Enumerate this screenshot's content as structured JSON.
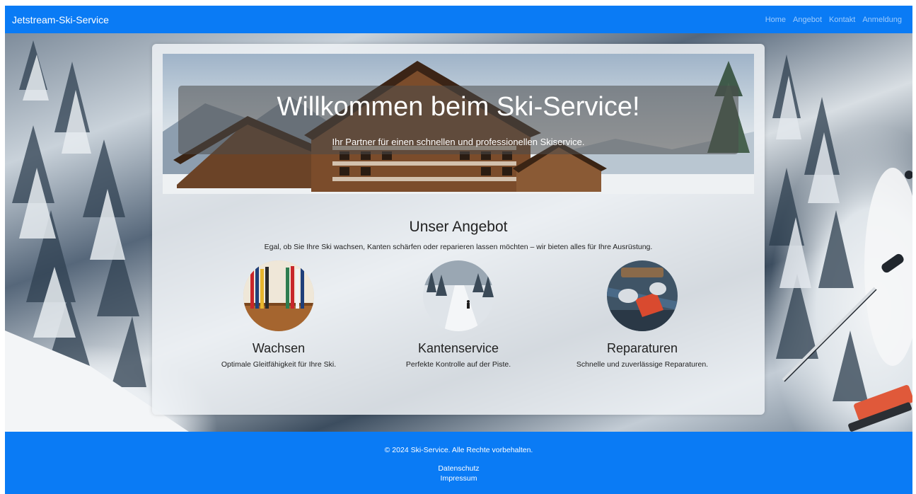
{
  "navbar": {
    "brand": "Jetstream-Ski-Service",
    "links": [
      "Home",
      "Angebot",
      "Kontakt",
      "Anmeldung"
    ]
  },
  "hero": {
    "title": "Willkommen beim Ski-Service!",
    "subtitle": "Ihr Partner für einen schnellen und professionellen Skiservice."
  },
  "offer": {
    "title": "Unser Angebot",
    "subtitle": "Egal, ob Sie Ihre Ski wachsen, Kanten schärfen oder reparieren lassen möchten – wir bieten alles für Ihre Ausrüstung.",
    "services": [
      {
        "title": "Wachsen",
        "description": "Optimale Gleitfähigkeit für Ihre Ski."
      },
      {
        "title": "Kantenservice",
        "description": "Perfekte Kontrolle auf der Piste."
      },
      {
        "title": "Reparaturen",
        "description": "Schnelle und zuverlässige Reparaturen."
      }
    ]
  },
  "footer": {
    "copyright": "© 2024 Ski-Service. Alle Rechte vorbehalten.",
    "links": [
      "Datenschutz",
      "Impressum"
    ]
  },
  "colors": {
    "brand_blue": "#0a7bf5"
  },
  "icons": [
    "ski-rack-image",
    "ski-slope-image",
    "ski-repair-image",
    "chalet-image"
  ]
}
